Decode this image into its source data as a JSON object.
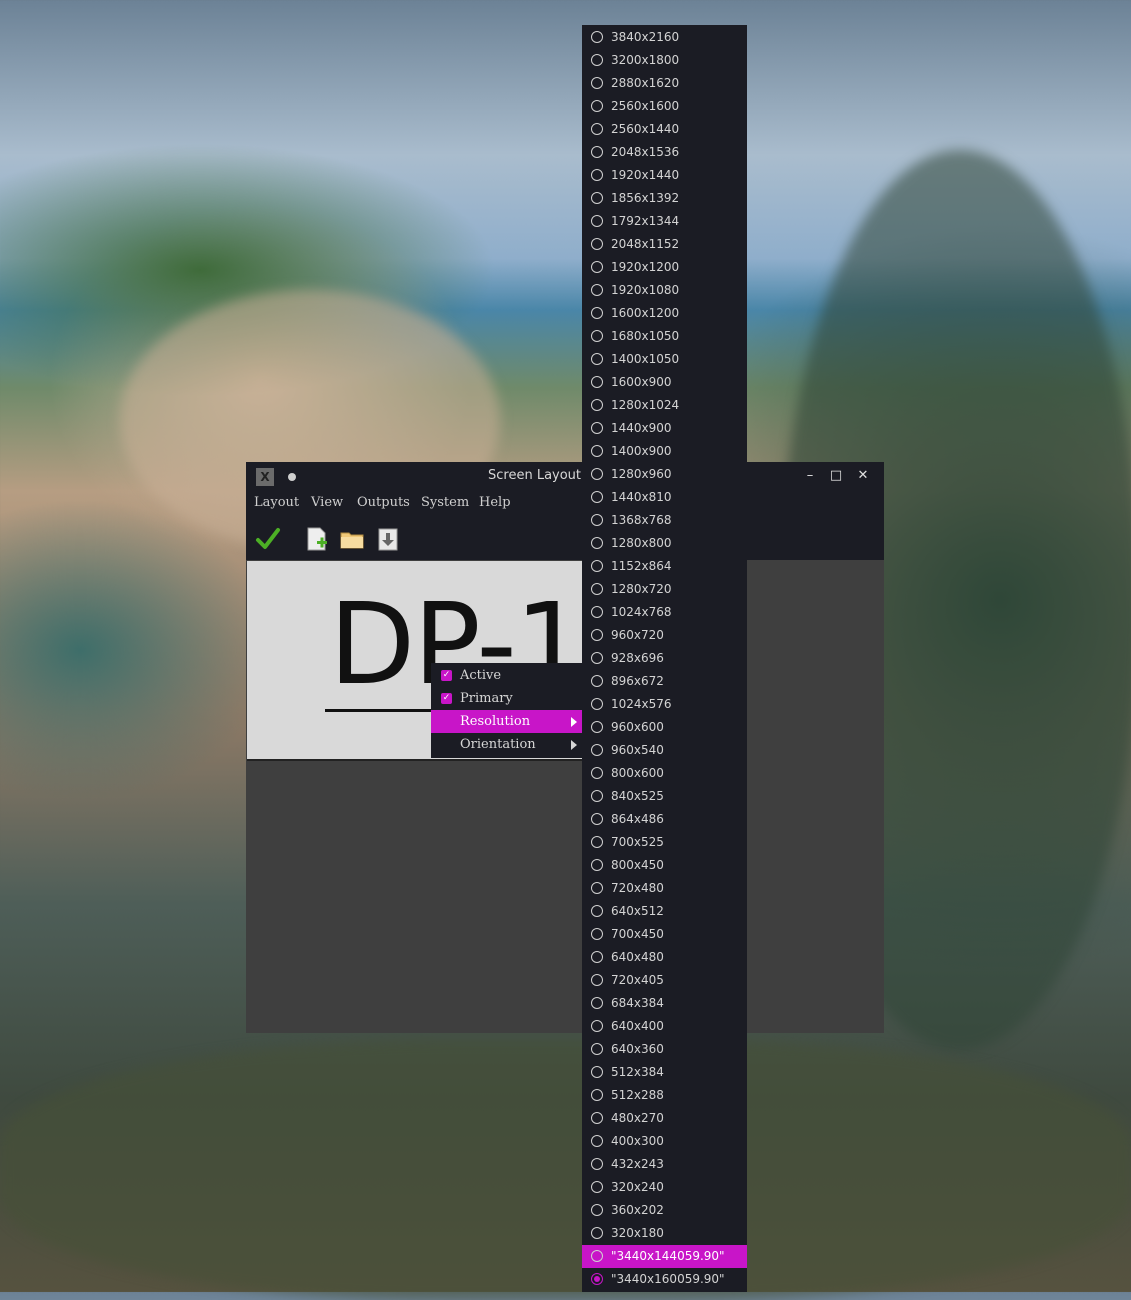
{
  "window": {
    "title": "Screen Layout E",
    "app_icon": "X",
    "minimize_icon": "–",
    "maximize_icon": "□",
    "close_icon": "✕"
  },
  "menubar": [
    "Layout",
    "View",
    "Outputs",
    "System",
    "Help"
  ],
  "toolbar": {
    "apply_icon": "checkmark-icon",
    "new_icon": "new-document-icon",
    "open_icon": "folder-icon",
    "save_icon": "save-download-icon"
  },
  "canvas": {
    "output_label": "DP-1"
  },
  "context_menu": {
    "items": [
      {
        "label": "Active",
        "checked": true
      },
      {
        "label": "Primary",
        "checked": true
      },
      {
        "label": "Resolution",
        "submenu": true
      },
      {
        "label": "Orientation",
        "submenu": true
      }
    ]
  },
  "resolutions": [
    "3840x2160",
    "3200x1800",
    "2880x1620",
    "2560x1600",
    "2560x1440",
    "2048x1536",
    "1920x1440",
    "1856x1392",
    "1792x1344",
    "2048x1152",
    "1920x1200",
    "1920x1080",
    "1600x1200",
    "1680x1050",
    "1400x1050",
    "1600x900",
    "1280x1024",
    "1440x900",
    "1400x900",
    "1280x960",
    "1440x810",
    "1368x768",
    "1280x800",
    "1152x864",
    "1280x720",
    "1024x768",
    "960x720",
    "928x696",
    "896x672",
    "1024x576",
    "960x600",
    "960x540",
    "800x600",
    "840x525",
    "864x486",
    "700x525",
    "800x450",
    "720x480",
    "640x512",
    "700x450",
    "640x480",
    "720x405",
    "684x384",
    "640x400",
    "640x360",
    "512x384",
    "512x288",
    "480x270",
    "400x300",
    "432x243",
    "320x240",
    "360x202",
    "320x180",
    "\"3440x144059.90\"",
    "\"3440x160059.90\""
  ],
  "resolution_highlighted": "\"3440x144059.90\"",
  "resolution_selected": "\"3440x160059.90\"",
  "colors": {
    "accent": "#c815c8",
    "panel": "#1b1c24",
    "canvas": "#d9d9d9"
  }
}
